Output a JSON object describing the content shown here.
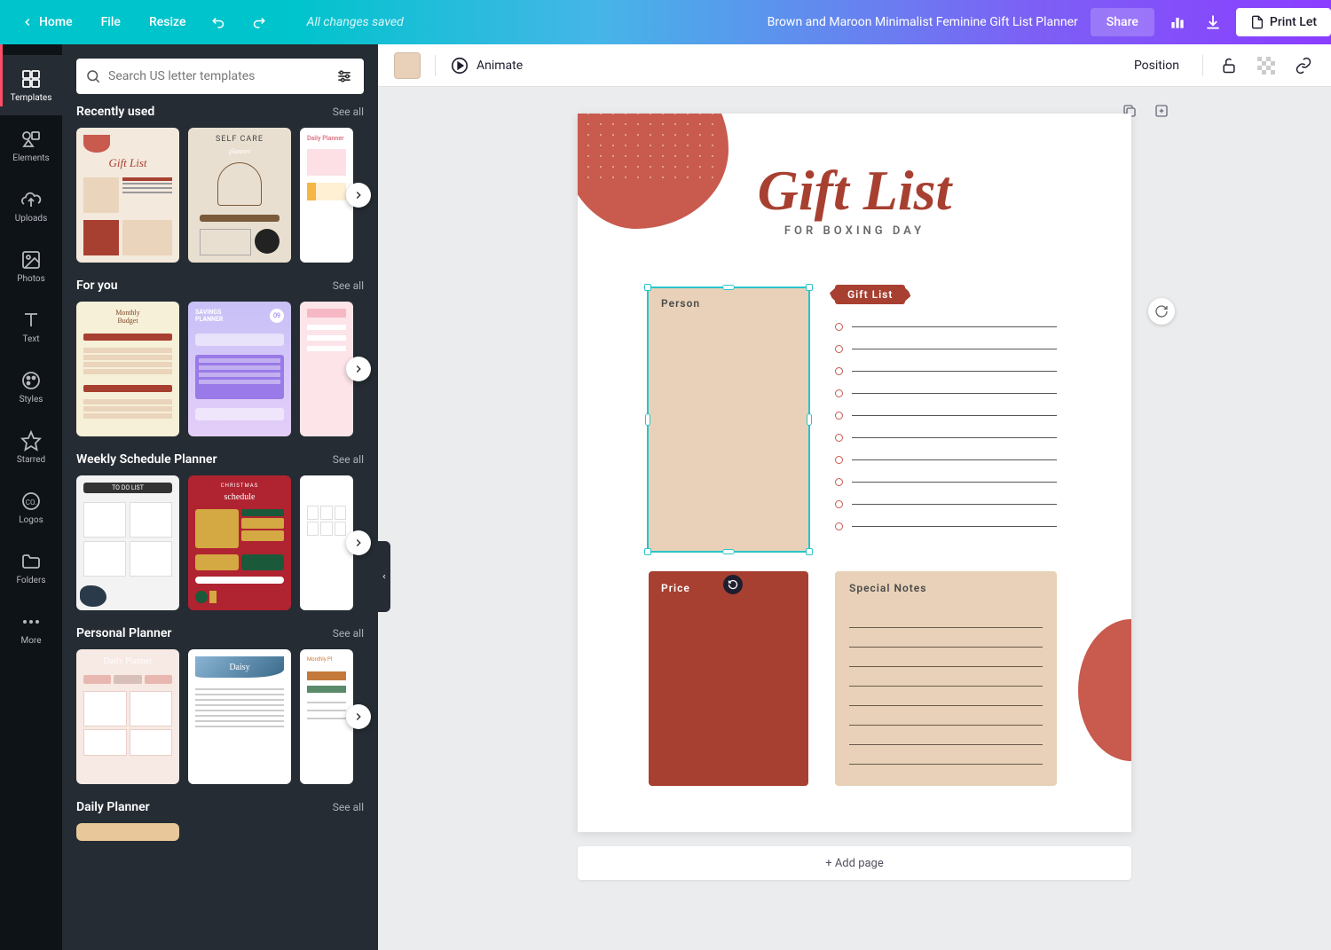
{
  "topbar": {
    "home": "Home",
    "file": "File",
    "resize": "Resize",
    "status": "All changes saved",
    "doc_title": "Brown and Maroon Minimalist Feminine Gift List Planner",
    "share": "Share",
    "print": "Print Let"
  },
  "rail": {
    "templates": "Templates",
    "elements": "Elements",
    "uploads": "Uploads",
    "photos": "Photos",
    "text": "Text",
    "styles": "Styles",
    "starred": "Starred",
    "logos": "Logos",
    "folders": "Folders",
    "more": "More"
  },
  "panel": {
    "search_placeholder": "Search US letter templates",
    "sections": {
      "recently_used": {
        "title": "Recently used",
        "see_all": "See all"
      },
      "for_you": {
        "title": "For you",
        "see_all": "See all"
      },
      "weekly": {
        "title": "Weekly Schedule Planner",
        "see_all": "See all"
      },
      "personal": {
        "title": "Personal Planner",
        "see_all": "See all"
      },
      "daily": {
        "title": "Daily Planner",
        "see_all": "See all"
      }
    }
  },
  "context": {
    "animate": "Animate",
    "position": "Position"
  },
  "page": {
    "title_script": "Gift List",
    "title_sub": "FOR BOXING DAY",
    "person_label": "Person",
    "giftlist_label": "Gift List",
    "price_label": "Price",
    "notes_label": "Special Notes"
  },
  "add_page": "+ Add page",
  "swatch_color": "#e8d1b8"
}
